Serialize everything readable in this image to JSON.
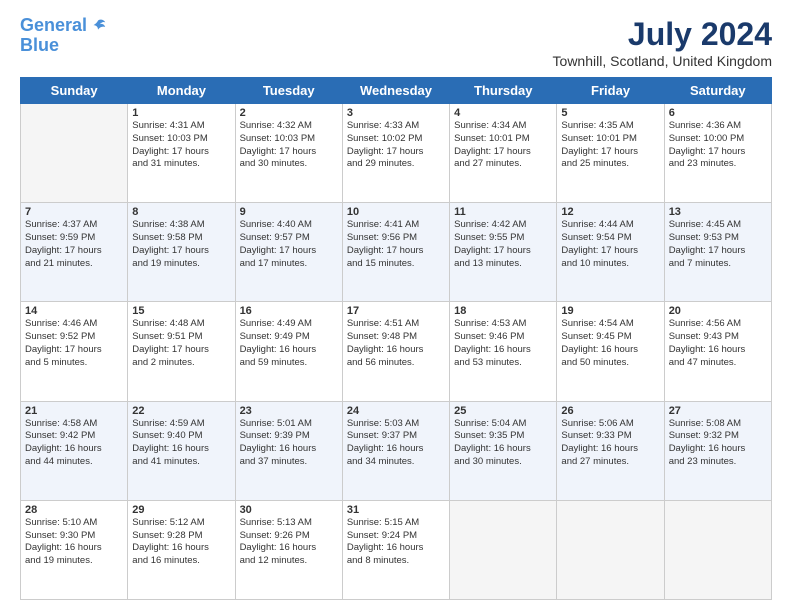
{
  "header": {
    "logo_line1": "General",
    "logo_line2": "Blue",
    "month": "July 2024",
    "location": "Townhill, Scotland, United Kingdom"
  },
  "days_of_week": [
    "Sunday",
    "Monday",
    "Tuesday",
    "Wednesday",
    "Thursday",
    "Friday",
    "Saturday"
  ],
  "weeks": [
    [
      {
        "day": "",
        "text": ""
      },
      {
        "day": "1",
        "text": "Sunrise: 4:31 AM\nSunset: 10:03 PM\nDaylight: 17 hours\nand 31 minutes."
      },
      {
        "day": "2",
        "text": "Sunrise: 4:32 AM\nSunset: 10:03 PM\nDaylight: 17 hours\nand 30 minutes."
      },
      {
        "day": "3",
        "text": "Sunrise: 4:33 AM\nSunset: 10:02 PM\nDaylight: 17 hours\nand 29 minutes."
      },
      {
        "day": "4",
        "text": "Sunrise: 4:34 AM\nSunset: 10:01 PM\nDaylight: 17 hours\nand 27 minutes."
      },
      {
        "day": "5",
        "text": "Sunrise: 4:35 AM\nSunset: 10:01 PM\nDaylight: 17 hours\nand 25 minutes."
      },
      {
        "day": "6",
        "text": "Sunrise: 4:36 AM\nSunset: 10:00 PM\nDaylight: 17 hours\nand 23 minutes."
      }
    ],
    [
      {
        "day": "7",
        "text": "Sunrise: 4:37 AM\nSunset: 9:59 PM\nDaylight: 17 hours\nand 21 minutes."
      },
      {
        "day": "8",
        "text": "Sunrise: 4:38 AM\nSunset: 9:58 PM\nDaylight: 17 hours\nand 19 minutes."
      },
      {
        "day": "9",
        "text": "Sunrise: 4:40 AM\nSunset: 9:57 PM\nDaylight: 17 hours\nand 17 minutes."
      },
      {
        "day": "10",
        "text": "Sunrise: 4:41 AM\nSunset: 9:56 PM\nDaylight: 17 hours\nand 15 minutes."
      },
      {
        "day": "11",
        "text": "Sunrise: 4:42 AM\nSunset: 9:55 PM\nDaylight: 17 hours\nand 13 minutes."
      },
      {
        "day": "12",
        "text": "Sunrise: 4:44 AM\nSunset: 9:54 PM\nDaylight: 17 hours\nand 10 minutes."
      },
      {
        "day": "13",
        "text": "Sunrise: 4:45 AM\nSunset: 9:53 PM\nDaylight: 17 hours\nand 7 minutes."
      }
    ],
    [
      {
        "day": "14",
        "text": "Sunrise: 4:46 AM\nSunset: 9:52 PM\nDaylight: 17 hours\nand 5 minutes."
      },
      {
        "day": "15",
        "text": "Sunrise: 4:48 AM\nSunset: 9:51 PM\nDaylight: 17 hours\nand 2 minutes."
      },
      {
        "day": "16",
        "text": "Sunrise: 4:49 AM\nSunset: 9:49 PM\nDaylight: 16 hours\nand 59 minutes."
      },
      {
        "day": "17",
        "text": "Sunrise: 4:51 AM\nSunset: 9:48 PM\nDaylight: 16 hours\nand 56 minutes."
      },
      {
        "day": "18",
        "text": "Sunrise: 4:53 AM\nSunset: 9:46 PM\nDaylight: 16 hours\nand 53 minutes."
      },
      {
        "day": "19",
        "text": "Sunrise: 4:54 AM\nSunset: 9:45 PM\nDaylight: 16 hours\nand 50 minutes."
      },
      {
        "day": "20",
        "text": "Sunrise: 4:56 AM\nSunset: 9:43 PM\nDaylight: 16 hours\nand 47 minutes."
      }
    ],
    [
      {
        "day": "21",
        "text": "Sunrise: 4:58 AM\nSunset: 9:42 PM\nDaylight: 16 hours\nand 44 minutes."
      },
      {
        "day": "22",
        "text": "Sunrise: 4:59 AM\nSunset: 9:40 PM\nDaylight: 16 hours\nand 41 minutes."
      },
      {
        "day": "23",
        "text": "Sunrise: 5:01 AM\nSunset: 9:39 PM\nDaylight: 16 hours\nand 37 minutes."
      },
      {
        "day": "24",
        "text": "Sunrise: 5:03 AM\nSunset: 9:37 PM\nDaylight: 16 hours\nand 34 minutes."
      },
      {
        "day": "25",
        "text": "Sunrise: 5:04 AM\nSunset: 9:35 PM\nDaylight: 16 hours\nand 30 minutes."
      },
      {
        "day": "26",
        "text": "Sunrise: 5:06 AM\nSunset: 9:33 PM\nDaylight: 16 hours\nand 27 minutes."
      },
      {
        "day": "27",
        "text": "Sunrise: 5:08 AM\nSunset: 9:32 PM\nDaylight: 16 hours\nand 23 minutes."
      }
    ],
    [
      {
        "day": "28",
        "text": "Sunrise: 5:10 AM\nSunset: 9:30 PM\nDaylight: 16 hours\nand 19 minutes."
      },
      {
        "day": "29",
        "text": "Sunrise: 5:12 AM\nSunset: 9:28 PM\nDaylight: 16 hours\nand 16 minutes."
      },
      {
        "day": "30",
        "text": "Sunrise: 5:13 AM\nSunset: 9:26 PM\nDaylight: 16 hours\nand 12 minutes."
      },
      {
        "day": "31",
        "text": "Sunrise: 5:15 AM\nSunset: 9:24 PM\nDaylight: 16 hours\nand 8 minutes."
      },
      {
        "day": "",
        "text": ""
      },
      {
        "day": "",
        "text": ""
      },
      {
        "day": "",
        "text": ""
      }
    ]
  ]
}
